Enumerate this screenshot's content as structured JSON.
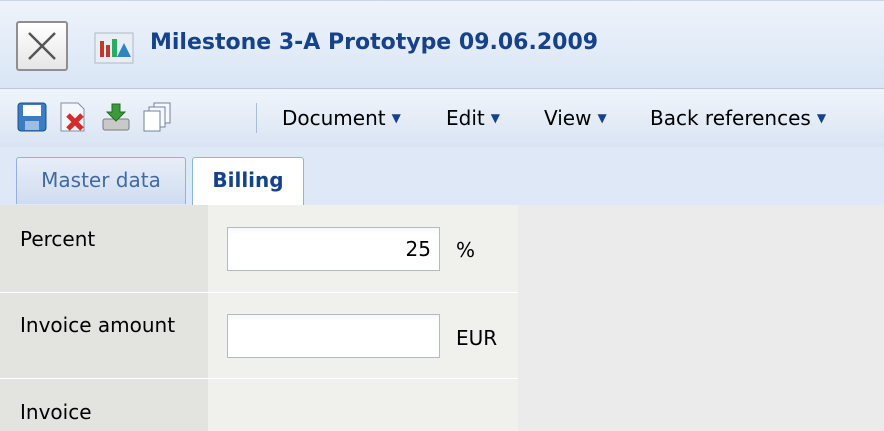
{
  "window": {
    "title": "Milestone 3-A Prototype 09.06.2009",
    "close_icon": "close-icon",
    "app_icon": "app-icon"
  },
  "toolbar": {
    "icons": [
      "save-icon",
      "delete-icon",
      "download-icon",
      "copy-icon"
    ],
    "menus": [
      {
        "label": "Document"
      },
      {
        "label": "Edit"
      },
      {
        "label": "View"
      },
      {
        "label": "Back references"
      }
    ],
    "arrow": "▼"
  },
  "tabs": [
    {
      "label": "Master data",
      "active": false
    },
    {
      "label": "Billing",
      "active": true
    }
  ],
  "form": {
    "fields": [
      {
        "label": "Percent",
        "value": "25",
        "unit": "%"
      },
      {
        "label": "Invoice amount",
        "value": "",
        "unit": "EUR"
      },
      {
        "label": "Invoice"
      }
    ]
  },
  "colors": {
    "title_text": "#15428b",
    "toolbar_bg": "#d9e4f3",
    "label_col_bg": "#e3e3df"
  }
}
